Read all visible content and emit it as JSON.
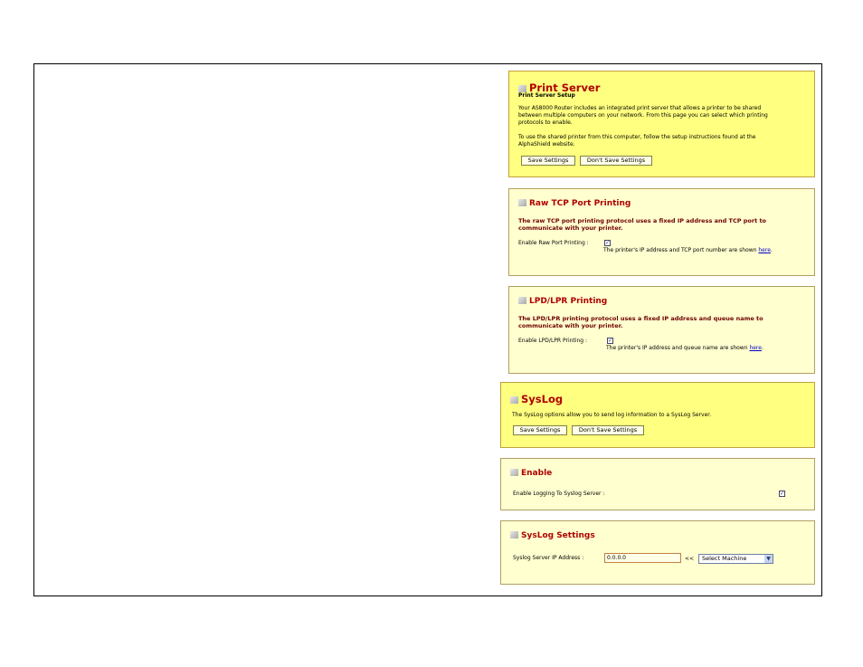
{
  "print_server": {
    "title": "Print Server",
    "subtitle": "Print Server Setup",
    "description_lines": [
      "Your AS8000 Router includes an integrated print server that allows a printer to be shared",
      "between multiple computers on your network. From this page you can select which printing",
      "protocols to enable."
    ],
    "instruction_lines": [
      "To use the shared printer from this computer, follow the setup instructions found at the",
      "AlphaShield website."
    ],
    "save_label": "Save Settings",
    "dont_save_label": "Don't Save Settings"
  },
  "raw_tcp": {
    "title": "Raw TCP Port Printing",
    "description_lines": [
      "The raw TCP port printing protocol uses a fixed IP address and TCP port to",
      "communicate with your printer."
    ],
    "enable_label": "Enable Raw Port Printing :",
    "checked_mark": "✓",
    "note_text": "The printer's IP address and TCP port number are shown ",
    "note_link": "here",
    "note_end": "."
  },
  "lpd": {
    "title": "LPD/LPR Printing",
    "description_lines": [
      "The LPD/LPR printing protocol uses a fixed IP address and queue name to",
      "communicate with your printer."
    ],
    "enable_label": "Enable LPD/LPR Printing :",
    "checked_mark": "✓",
    "note_text": "The printer's IP address and queue name are shown ",
    "note_link": "here",
    "note_end": "."
  },
  "syslog": {
    "title": "SysLog",
    "description": "The SysLog options allow you to send log information to a SysLog Server.",
    "save_label": "Save Settings",
    "dont_save_label": "Don't Save Settings"
  },
  "enable": {
    "title": "Enable",
    "label": "Enable Logging To Syslog Server :",
    "checked_mark": "✓"
  },
  "syslog_settings": {
    "title": "SysLog Settings",
    "ip_label": "Syslog Server IP Address :",
    "ip_value": "0.0.0.0",
    "arrows": "<<",
    "select_value": "Select Machine",
    "select_arrow": "▼"
  }
}
